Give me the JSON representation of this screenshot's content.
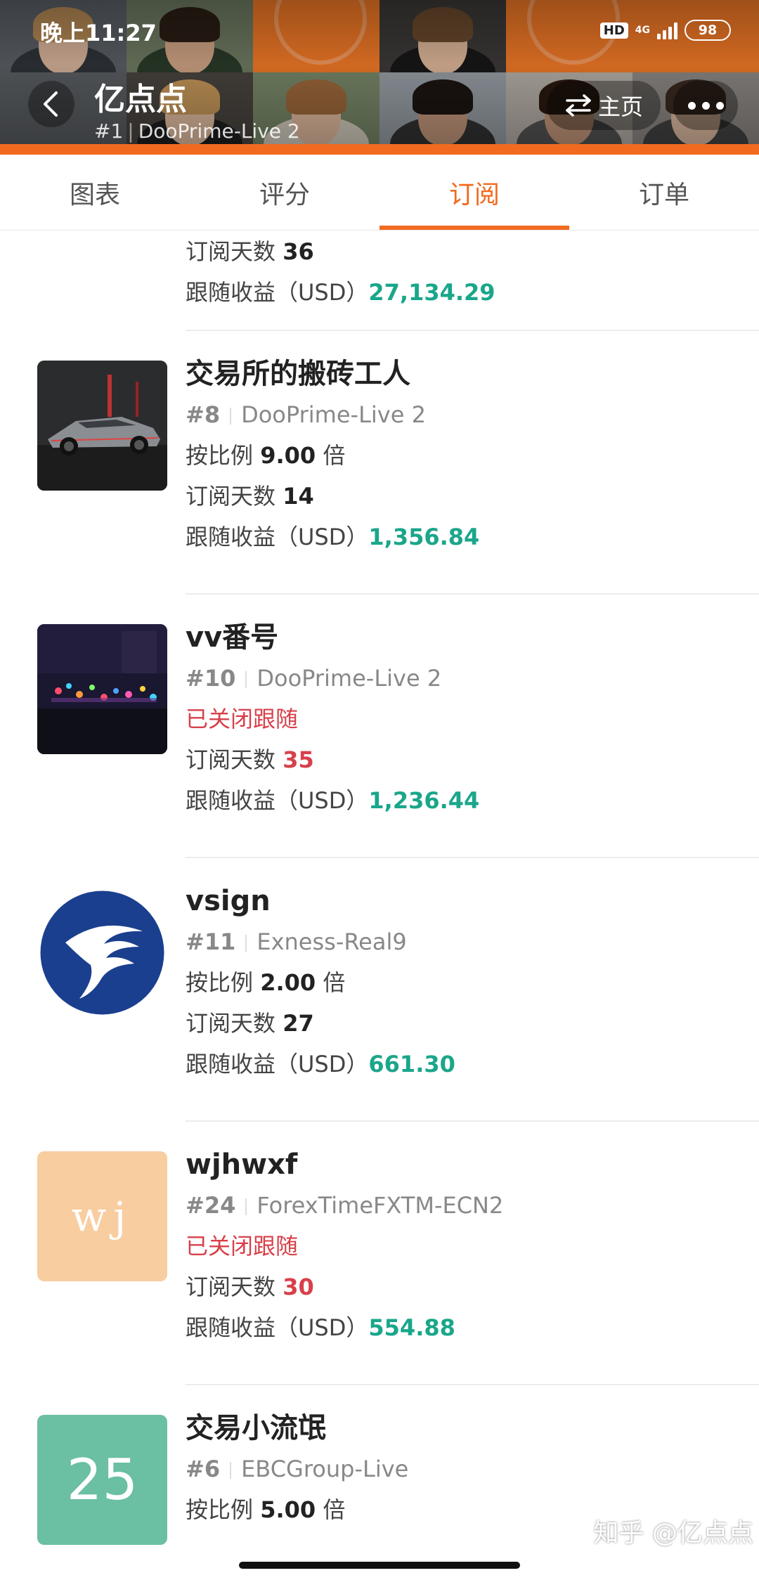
{
  "status_bar": {
    "time": "晚上11:27",
    "hd": "HD",
    "network": "4G",
    "battery": "98"
  },
  "header": {
    "title": "亿点点",
    "rank": "#1",
    "server": "DooPrime-Live 2",
    "home_label": "主页",
    "back_icon": "chevron-left-icon",
    "home_icon": "swap-arrows-icon",
    "more_icon": "ellipsis-icon"
  },
  "tabs": [
    {
      "label": "图表",
      "active": false
    },
    {
      "label": "评分",
      "active": false
    },
    {
      "label": "订阅",
      "active": true
    },
    {
      "label": "订单",
      "active": false
    }
  ],
  "labels": {
    "ratio": "按比例",
    "ratio_unit": "倍",
    "days": "订阅天数",
    "profit": "跟随收益（USD）",
    "closed": "已关闭跟随"
  },
  "partial_entry": {
    "days": "36",
    "profit": "27,134.29"
  },
  "entries": [
    {
      "name": "交易所的搬砖工人",
      "rank": "#8",
      "server": "DooPrime-Live 2",
      "ratio": "9.00",
      "closed": false,
      "days": "14",
      "profit": "1,356.84",
      "avatar_text": ""
    },
    {
      "name": "vv番号",
      "rank": "#10",
      "server": "DooPrime-Live 2",
      "ratio": "",
      "closed": true,
      "days": "35",
      "profit": "1,236.44",
      "avatar_text": ""
    },
    {
      "name": "vsign",
      "rank": "#11",
      "server": "Exness-Real9",
      "ratio": "2.00",
      "closed": false,
      "days": "27",
      "profit": "661.30",
      "avatar_text": ""
    },
    {
      "name": "wjhwxf",
      "rank": "#24",
      "server": "ForexTimeFXTM-ECN2",
      "ratio": "",
      "closed": true,
      "days": "30",
      "profit": "554.88",
      "avatar_text": "wj"
    },
    {
      "name": "交易小流氓",
      "rank": "#6",
      "server": "EBCGroup-Live",
      "ratio": "5.00",
      "closed": false,
      "days": "",
      "profit": "",
      "avatar_text": "25"
    }
  ],
  "colors": {
    "accent": "#f26a1f",
    "profit_green": "#1aa68a",
    "closed_red": "#d8404a"
  },
  "watermark": "知乎 @亿点点"
}
